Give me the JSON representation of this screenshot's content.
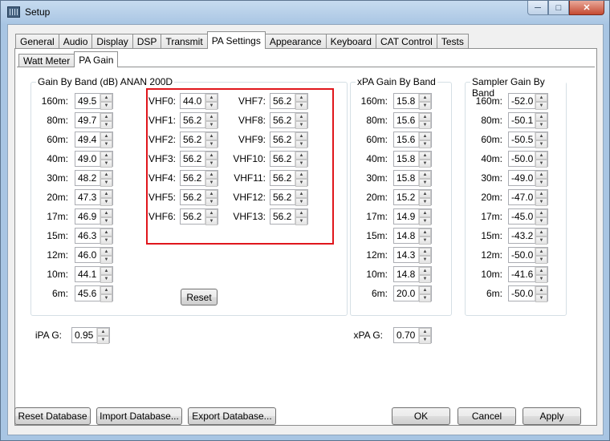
{
  "window": {
    "title": "Setup"
  },
  "tabs": [
    "General",
    "Audio",
    "Display",
    "DSP",
    "Transmit",
    "PA Settings",
    "Appearance",
    "Keyboard",
    "CAT Control",
    "Tests"
  ],
  "active_tab": "PA Settings",
  "subtabs": [
    "Watt Meter",
    "PA Gain"
  ],
  "active_subtab": "PA Gain",
  "gain_by_band": {
    "title": "Gain By Band (dB) ANAN 200D",
    "rows": [
      {
        "label": "160m:",
        "value": "49.5"
      },
      {
        "label": "80m:",
        "value": "49.7"
      },
      {
        "label": "60m:",
        "value": "49.4"
      },
      {
        "label": "40m:",
        "value": "49.0"
      },
      {
        "label": "30m:",
        "value": "48.2"
      },
      {
        "label": "20m:",
        "value": "47.3"
      },
      {
        "label": "17m:",
        "value": "46.9"
      },
      {
        "label": "15m:",
        "value": "46.3"
      },
      {
        "label": "12m:",
        "value": "46.0"
      },
      {
        "label": "10m:",
        "value": "44.1"
      },
      {
        "label": "6m:",
        "value": "45.6"
      }
    ],
    "vhf_left": [
      {
        "label": "VHF0:",
        "value": "44.0"
      },
      {
        "label": "VHF1:",
        "value": "56.2"
      },
      {
        "label": "VHF2:",
        "value": "56.2"
      },
      {
        "label": "VHF3:",
        "value": "56.2"
      },
      {
        "label": "VHF4:",
        "value": "56.2"
      },
      {
        "label": "VHF5:",
        "value": "56.2"
      },
      {
        "label": "VHF6:",
        "value": "56.2"
      }
    ],
    "vhf_right": [
      {
        "label": "VHF7:",
        "value": "56.2"
      },
      {
        "label": "VHF8:",
        "value": "56.2"
      },
      {
        "label": "VHF9:",
        "value": "56.2"
      },
      {
        "label": "VHF10:",
        "value": "56.2"
      },
      {
        "label": "VHF11:",
        "value": "56.2"
      },
      {
        "label": "VHF12:",
        "value": "56.2"
      },
      {
        "label": "VHF13:",
        "value": "56.2"
      }
    ],
    "reset_label": "Reset"
  },
  "xpa_gain_by_band": {
    "title": "xPA Gain By Band",
    "rows": [
      {
        "label": "160m:",
        "value": "15.8"
      },
      {
        "label": "80m:",
        "value": "15.6"
      },
      {
        "label": "60m:",
        "value": "15.6"
      },
      {
        "label": "40m:",
        "value": "15.8"
      },
      {
        "label": "30m:",
        "value": "15.8"
      },
      {
        "label": "20m:",
        "value": "15.2"
      },
      {
        "label": "17m:",
        "value": "14.9"
      },
      {
        "label": "15m:",
        "value": "14.8"
      },
      {
        "label": "12m:",
        "value": "14.3"
      },
      {
        "label": "10m:",
        "value": "14.8"
      },
      {
        "label": "6m:",
        "value": "20.0"
      }
    ]
  },
  "sampler_gain_by_band": {
    "title": "Sampler Gain By Band",
    "rows": [
      {
        "label": "160m:",
        "value": "-52.0"
      },
      {
        "label": "80m:",
        "value": "-50.1"
      },
      {
        "label": "60m:",
        "value": "-50.5"
      },
      {
        "label": "40m:",
        "value": "-50.0"
      },
      {
        "label": "30m:",
        "value": "-49.0"
      },
      {
        "label": "20m:",
        "value": "-47.0"
      },
      {
        "label": "17m:",
        "value": "-45.0"
      },
      {
        "label": "15m:",
        "value": "-43.2"
      },
      {
        "label": "12m:",
        "value": "-50.0"
      },
      {
        "label": "10m:",
        "value": "-41.6"
      },
      {
        "label": "6m:",
        "value": "-50.0"
      }
    ]
  },
  "ipa_g": {
    "label": "iPA G:",
    "value": "0.95"
  },
  "xpa_g": {
    "label": "xPA G:",
    "value": "0.70"
  },
  "buttons": {
    "reset_database": "Reset Database",
    "import_database": "Import Database...",
    "export_database": "Export Database...",
    "ok": "OK",
    "cancel": "Cancel",
    "apply": "Apply"
  },
  "icons": {
    "minimize": "minimize-icon",
    "maximize": "maximize-icon",
    "close": "close-icon",
    "spin_up": "up-arrow-icon",
    "spin_down": "down-arrow-icon"
  },
  "colors": {
    "highlight_box": "#e0161c"
  }
}
